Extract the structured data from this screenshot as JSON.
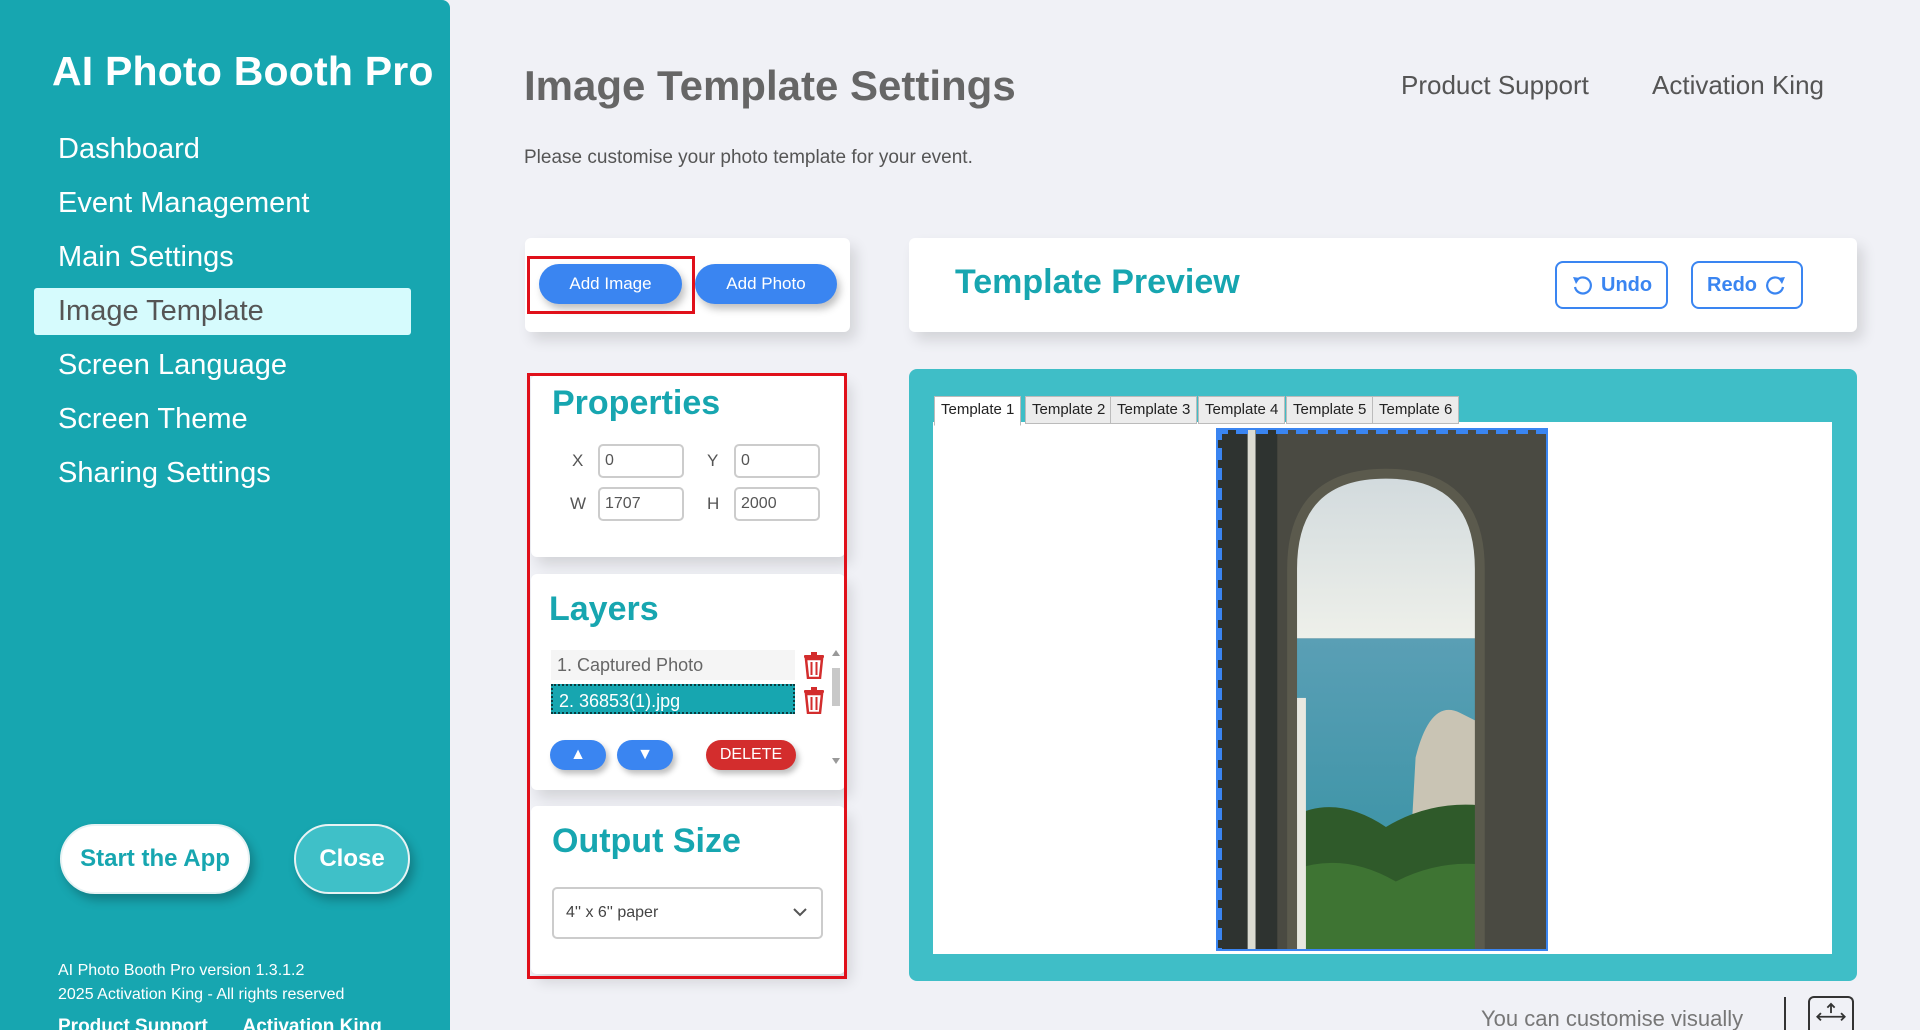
{
  "app": {
    "title": "AI Photo Booth Pro"
  },
  "sidebar": {
    "items": [
      {
        "label": "Dashboard"
      },
      {
        "label": "Event Management"
      },
      {
        "label": "Main Settings"
      },
      {
        "label": "Image Template"
      },
      {
        "label": "Screen Language"
      },
      {
        "label": "Screen Theme"
      },
      {
        "label": "Sharing Settings"
      }
    ],
    "active_index": 3,
    "start_label": "Start the App",
    "close_label": "Close",
    "version": "AI Photo Booth Pro version 1.3.1.2",
    "copyright": "2025 Activation King - All rights reserved",
    "footer_link_support": "Product Support",
    "footer_link_king": "Activation King"
  },
  "header": {
    "title": "Image Template Settings",
    "subtitle": "Please customise your photo template for your event.",
    "link_support": "Product Support",
    "link_king": "Activation King"
  },
  "toolbar": {
    "add_image_label": "Add Image",
    "add_photo_label": "Add Photo"
  },
  "properties": {
    "title": "Properties",
    "x_label": "X",
    "x_value": "0",
    "y_label": "Y",
    "y_value": "0",
    "w_label": "W",
    "w_value": "1707",
    "h_label": "H",
    "h_value": "2000"
  },
  "layers": {
    "title": "Layers",
    "items": [
      {
        "label": "1. Captured Photo"
      },
      {
        "label": "2. 36853(1).jpg"
      }
    ],
    "selected_index": 1,
    "up_glyph": "▲",
    "down_glyph": "▼",
    "delete_label": "DELETE"
  },
  "output": {
    "title": "Output Size",
    "selected": "4'' x 6'' paper"
  },
  "preview": {
    "title": "Template Preview",
    "undo_label": "Undo",
    "redo_label": "Redo",
    "tabs": [
      "Template 1",
      "Template 2",
      "Template 3",
      "Template 4",
      "Template 5",
      "Template 6"
    ],
    "active_tab": 0,
    "hint": "You can customise visually"
  },
  "colors": {
    "brand": "#17a6b0",
    "accent": "#3a85f1",
    "danger": "#d32d2d",
    "highlight": "#e0101a"
  }
}
